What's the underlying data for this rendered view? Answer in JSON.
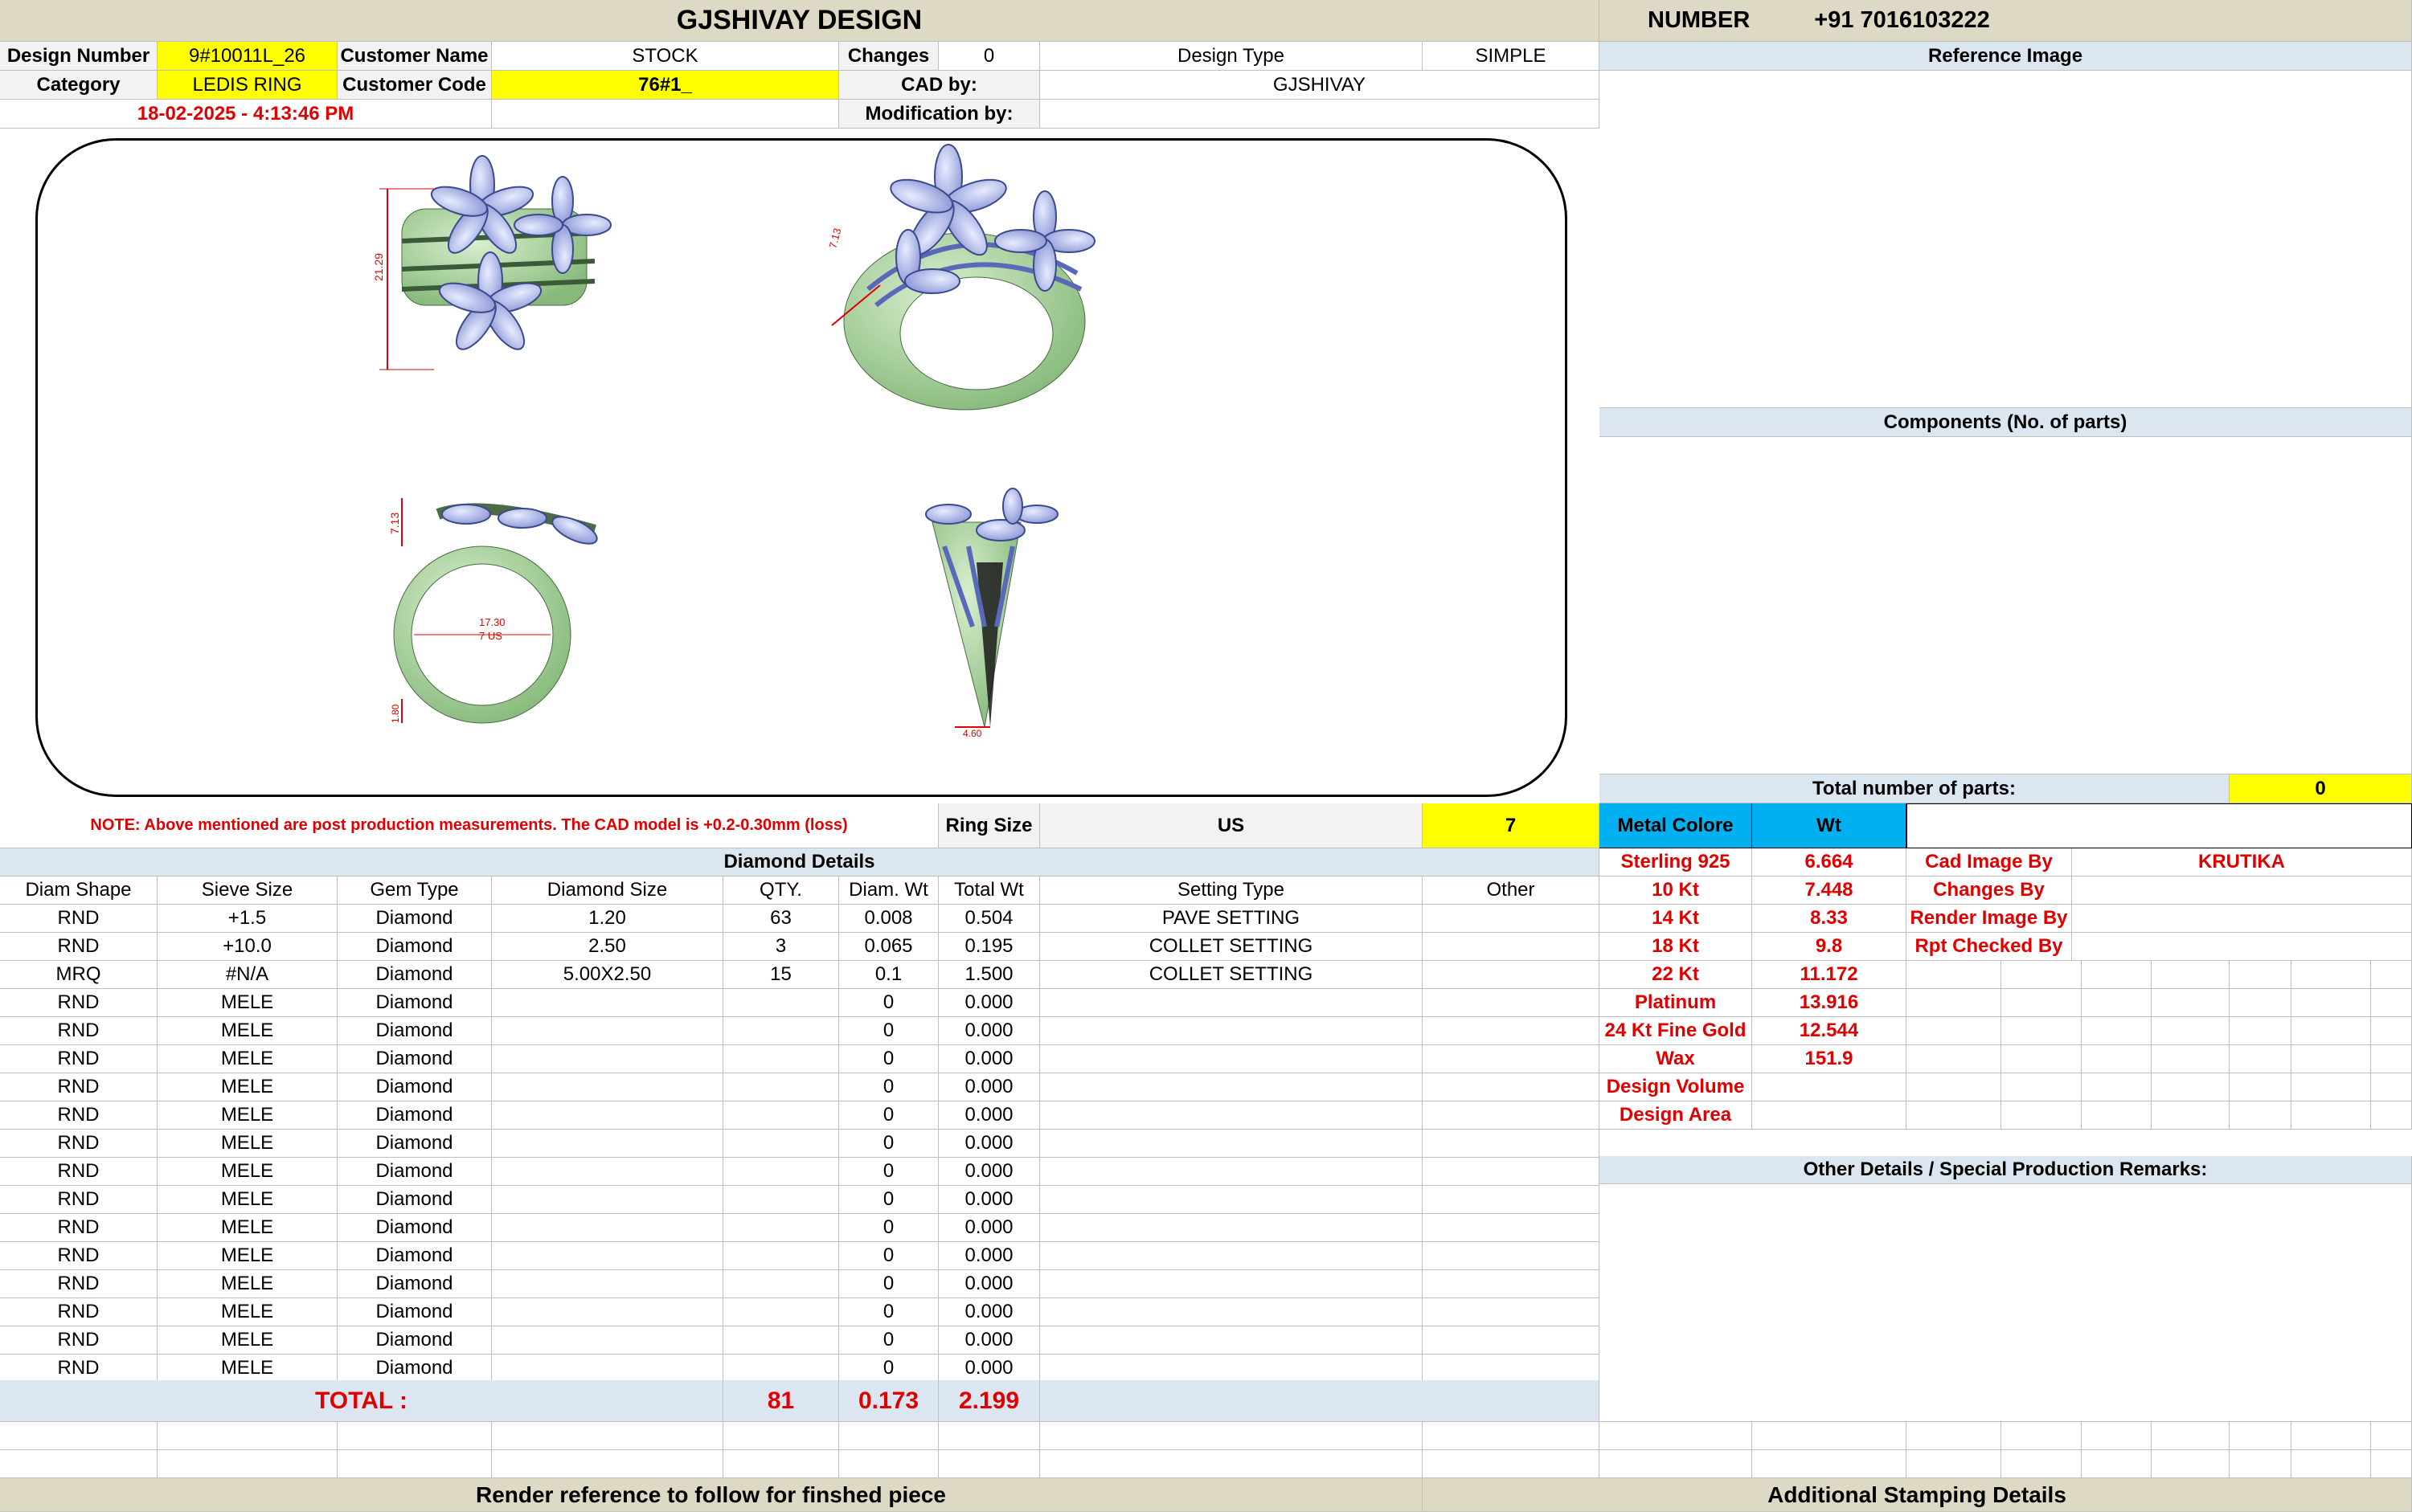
{
  "header": {
    "title": "GJSHIVAY DESIGN",
    "number_label": "NUMBER",
    "number_value": "+91 7016103222"
  },
  "info": {
    "design_number_label": "Design Number",
    "design_number": "9#10011L_26",
    "customer_name_label": "Customer Name",
    "customer_name": "STOCK",
    "changes_label": "Changes",
    "changes": "0",
    "design_type_label": "Design Type",
    "design_type": "SIMPLE",
    "category_label": "Category",
    "category": "LEDIS RING",
    "customer_code_label": "Customer Code",
    "customer_code": "76#1_",
    "cad_by_label": "CAD by:",
    "cad_by": "GJSHIVAY",
    "timestamp": "18-02-2025 - 4:13:46 PM",
    "modification_by_label": "Modification by:",
    "modification_by": ""
  },
  "drawing": {
    "dim_height": "21.29",
    "dim_top": "7.13",
    "dim_inner": "17.30",
    "dim_size": "7 US",
    "dim_band": "1.80",
    "dim_width": "4.60",
    "dim_persp": "7.13"
  },
  "right_panel": {
    "reference_image": "Reference Image",
    "components": "Components (No. of parts)",
    "total_parts_label": "Total number of parts:",
    "total_parts": "0",
    "other_details": "Other Details / Special Production Remarks:"
  },
  "note": "NOTE: Above mentioned are post production measurements. The CAD model is +0.2-0.30mm (loss)",
  "ring": {
    "label": "Ring Size",
    "unit": "US",
    "value": "7"
  },
  "metal": {
    "colore_label": "Metal Colore",
    "wt_label": "Wt",
    "rows": [
      {
        "name": "Sterling 925",
        "wt": "6.664"
      },
      {
        "name": "10 Kt",
        "wt": "7.448"
      },
      {
        "name": "14 Kt",
        "wt": "8.33"
      },
      {
        "name": "18 Kt",
        "wt": "9.8"
      },
      {
        "name": "22 Kt",
        "wt": "11.172"
      },
      {
        "name": "Platinum",
        "wt": "13.916"
      },
      {
        "name": "24 Kt Fine Gold",
        "wt": "12.544"
      },
      {
        "name": "Wax",
        "wt": "151.9"
      },
      {
        "name": "Design Volume",
        "wt": ""
      },
      {
        "name": "Design Area",
        "wt": ""
      }
    ]
  },
  "credits": {
    "cad_image_by_label": "Cad Image By",
    "cad_image_by": "KRUTIKA",
    "changes_by_label": "Changes By",
    "render_image_by_label": "Render Image By",
    "rpt_checked_by_label": "Rpt Checked By"
  },
  "diamond": {
    "title": "Diamond Details",
    "headers": [
      "Diam Shape",
      "Sieve Size",
      "Gem Type",
      "Diamond Size",
      "QTY.",
      "Diam. Wt",
      "Total Wt",
      "Setting Type",
      "Other"
    ],
    "rows": [
      [
        "RND",
        "+1.5",
        "Diamond",
        "1.20",
        "63",
        "0.008",
        "0.504",
        "PAVE SETTING",
        ""
      ],
      [
        "RND",
        "+10.0",
        "Diamond",
        "2.50",
        "3",
        "0.065",
        "0.195",
        "COLLET SETTING",
        ""
      ],
      [
        "MRQ",
        "#N/A",
        "Diamond",
        "5.00X2.50",
        "15",
        "0.1",
        "1.500",
        "COLLET SETTING",
        ""
      ],
      [
        "RND",
        "MELE",
        "Diamond",
        "",
        "",
        "0",
        "0.000",
        "",
        ""
      ],
      [
        "RND",
        "MELE",
        "Diamond",
        "",
        "",
        "0",
        "0.000",
        "",
        ""
      ],
      [
        "RND",
        "MELE",
        "Diamond",
        "",
        "",
        "0",
        "0.000",
        "",
        ""
      ],
      [
        "RND",
        "MELE",
        "Diamond",
        "",
        "",
        "0",
        "0.000",
        "",
        ""
      ],
      [
        "RND",
        "MELE",
        "Diamond",
        "",
        "",
        "0",
        "0.000",
        "",
        ""
      ],
      [
        "RND",
        "MELE",
        "Diamond",
        "",
        "",
        "0",
        "0.000",
        "",
        ""
      ],
      [
        "RND",
        "MELE",
        "Diamond",
        "",
        "",
        "0",
        "0.000",
        "",
        ""
      ],
      [
        "RND",
        "MELE",
        "Diamond",
        "",
        "",
        "0",
        "0.000",
        "",
        ""
      ],
      [
        "RND",
        "MELE",
        "Diamond",
        "",
        "",
        "0",
        "0.000",
        "",
        ""
      ],
      [
        "RND",
        "MELE",
        "Diamond",
        "",
        "",
        "0",
        "0.000",
        "",
        ""
      ],
      [
        "RND",
        "MELE",
        "Diamond",
        "",
        "",
        "0",
        "0.000",
        "",
        ""
      ],
      [
        "RND",
        "MELE",
        "Diamond",
        "",
        "",
        "0",
        "0.000",
        "",
        ""
      ],
      [
        "RND",
        "MELE",
        "Diamond",
        "",
        "",
        "0",
        "0.000",
        "",
        ""
      ],
      [
        "RND",
        "MELE",
        "Diamond",
        "",
        "",
        "0",
        "0.000",
        "",
        ""
      ]
    ],
    "total_label": "TOTAL :",
    "total_qty": "81",
    "total_diam_wt": "0.173",
    "total_wt": "2.199"
  },
  "footer": {
    "render_reference": "Render reference to follow for finshed piece",
    "additional_stamping": "Additional Stamping Details"
  }
}
